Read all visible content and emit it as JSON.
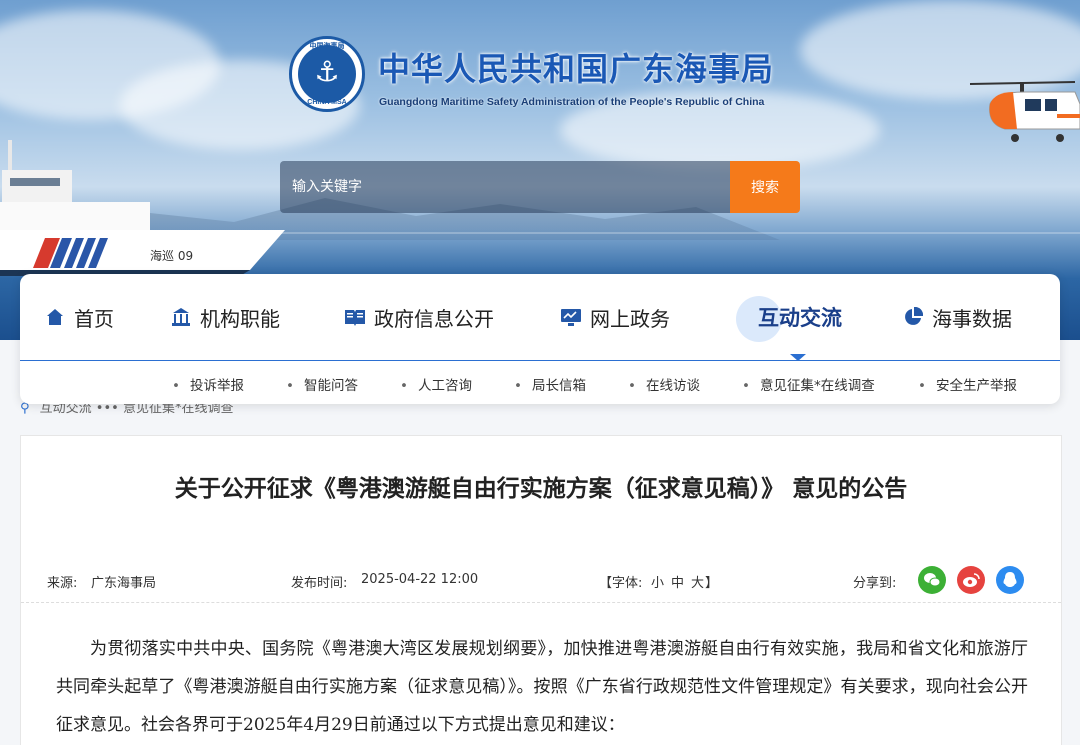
{
  "header": {
    "title": "中华人民共和国广东海事局",
    "subtitle": "Guangdong Maritime Safety Administration of the People's Republic of China",
    "emblem_top_text": "中国海事局",
    "emblem_bottom_text": "CHINA MSA",
    "ship_label": "海巡 09"
  },
  "search": {
    "placeholder": "输入关键字",
    "button_label": "搜索"
  },
  "nav": {
    "items": [
      {
        "label": "首页",
        "icon": "home-icon"
      },
      {
        "label": "机构职能",
        "icon": "building-icon"
      },
      {
        "label": "政府信息公开",
        "icon": "book-icon"
      },
      {
        "label": "网上政务",
        "icon": "monitor-icon"
      },
      {
        "label": "互动交流",
        "icon": "chat-icon",
        "active": true
      },
      {
        "label": "海事数据",
        "icon": "pie-chart-icon"
      }
    ],
    "sub_items": [
      "投诉举报",
      "智能问答",
      "人工咨询",
      "局长信箱",
      "在线访谈",
      "意见征集*在线调查",
      "安全生产举报"
    ]
  },
  "breadcrumb": {
    "text": "互动交流  •••  意见征集*在线调查"
  },
  "article": {
    "title": "关于公开征求《粤港澳游艇自由行实施方案（征求意见稿）》 意见的公告",
    "source_label": "来源:",
    "source_value": "广东海事局",
    "date_label": "发布时间:",
    "date_value": "2025-04-22 12:00",
    "font_label": "【字体:",
    "font_small": "小",
    "font_medium": "中",
    "font_large": "大",
    "font_close": "】",
    "share_label": "分享到:",
    "body": "为贯彻落实中共中央、国务院《粤港澳大湾区发展规划纲要》，加快推进粤港澳游艇自由行有效实施，我局和省文化和旅游厅共同牵头起草了《粤港澳游艇自由行实施方案（征求意见稿）》。按照《广东省行政规范性文件管理规定》有关要求，现向社会公开征求意见。社会各界可于2025年4月29日前通过以下方式提出意见和建议："
  },
  "colors": {
    "brand_blue": "#1a58b5",
    "search_button": "#f57a1a",
    "wechat": "#3cb035",
    "weibo": "#e6433f",
    "qq": "#2d8cf0"
  }
}
